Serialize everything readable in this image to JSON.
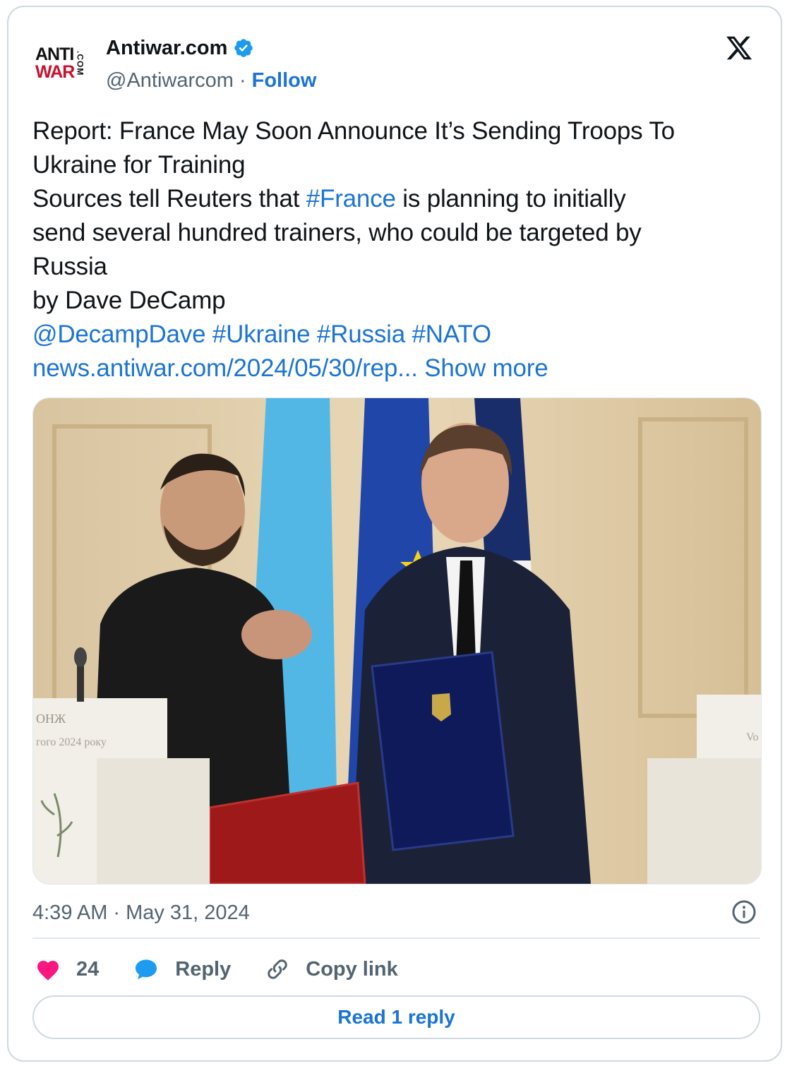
{
  "account": {
    "logo": {
      "line1": "ANTI",
      "line2": "WAR",
      "suffix": ".COM"
    },
    "display_name": "Antiwar.com",
    "verified_icon": "verified-badge-icon",
    "handle": "@Antiwarcom",
    "separator": "·",
    "follow_label": "Follow"
  },
  "platform_icon": "x-logo-icon",
  "tweet": {
    "line1": "Report: France May Soon Announce It’s Sending Troops To",
    "line2": "Ukraine for Training",
    "line3_pre": "Sources tell Reuters that ",
    "line3_tag": "#France",
    "line3_post": " is planning to initially",
    "line4": "send several hundred trainers, who could be targeted by",
    "line5": "Russia",
    "line6": "by Dave DeCamp",
    "mention": "@DecampDave",
    "tag_ukraine": "#Ukraine",
    "tag_russia": "#Russia",
    "tag_nato": "#NATO",
    "url": "news.antiwar.com/2024/05/30/rep...",
    "show_more": "Show more"
  },
  "photo": {
    "podium_text_1": "ОНЖ",
    "podium_text_2": "гого 2024 року",
    "podium_text_3": "Vo"
  },
  "meta": {
    "time": "4:39 AM",
    "separator": "·",
    "date": "May 31, 2024",
    "info_icon": "info-icon"
  },
  "actions": {
    "like_count": "24",
    "reply_label": "Reply",
    "copy_label": "Copy link"
  },
  "read_reply_label": "Read 1 reply",
  "colors": {
    "link": "#1b74d4",
    "like": "#f91880",
    "reply_icon": "#1d9bf0",
    "verified": "#1d9bf0",
    "muted": "#536471",
    "border": "#cfd9de"
  }
}
